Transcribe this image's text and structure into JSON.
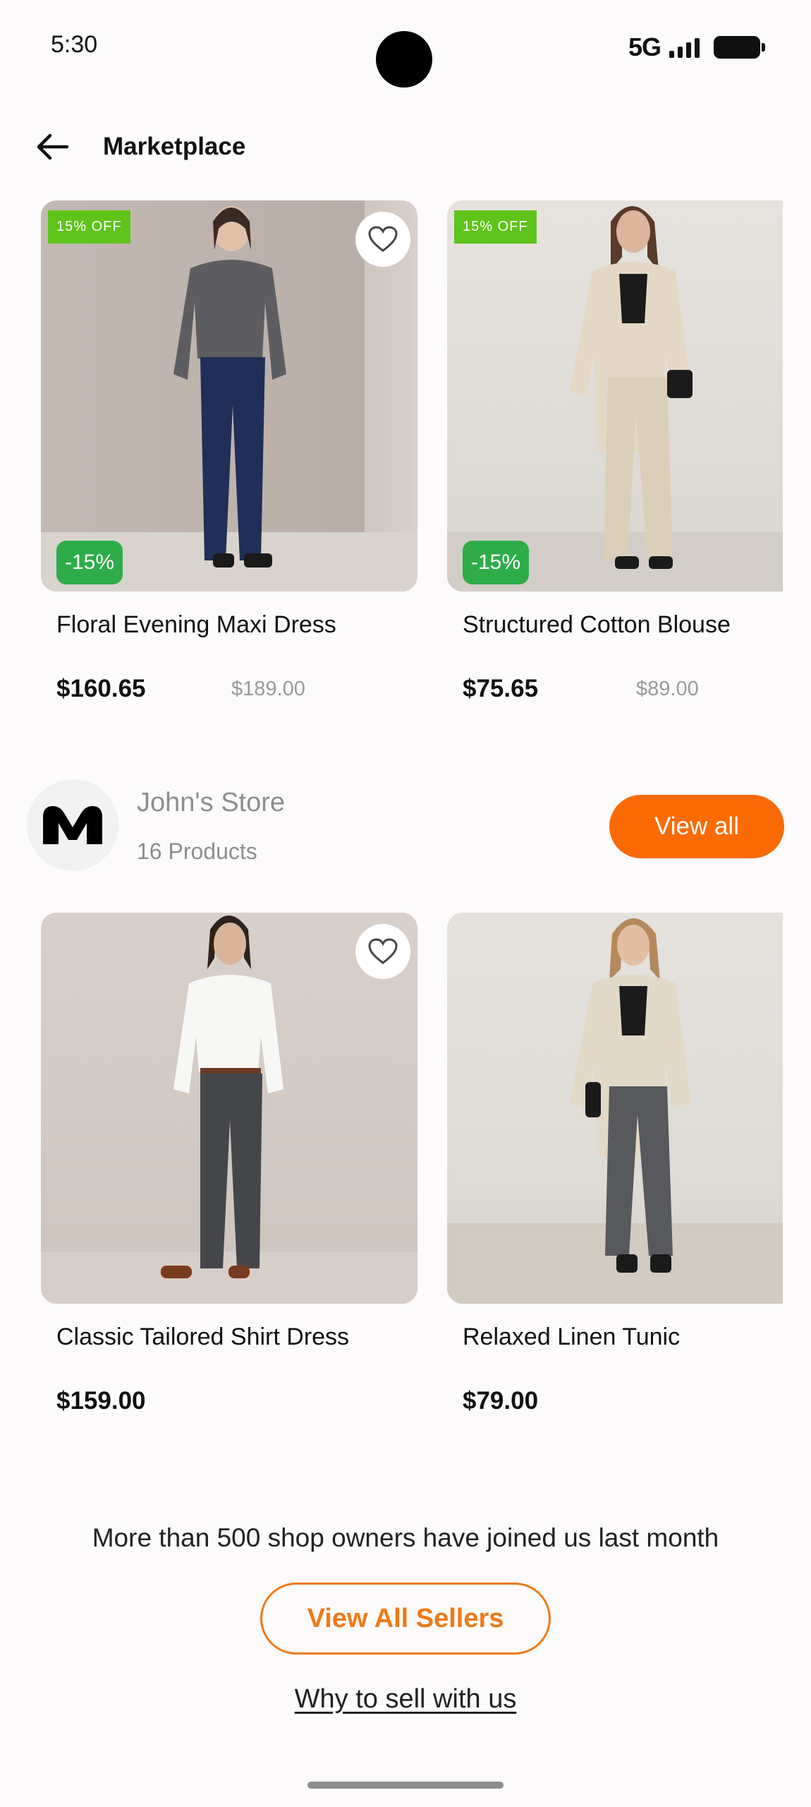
{
  "status_bar": {
    "time": "5:30",
    "network": "5G"
  },
  "header": {
    "title": "Marketplace"
  },
  "rows": [
    {
      "products": [
        {
          "name": "Floral Evening Maxi Dress",
          "price": "$160.65",
          "old_price": "$189.00",
          "off_label": "15% OFF",
          "discount": "-15%"
        },
        {
          "name": "Structured Cotton Blouse",
          "price": "$75.65",
          "old_price": "$89.00",
          "off_label": "15% OFF",
          "discount": "-15%"
        }
      ]
    },
    {
      "products": [
        {
          "name": "Classic Tailored Shirt Dress",
          "price": "$159.00"
        },
        {
          "name": "Relaxed Linen Tunic",
          "price": "$79.00"
        }
      ]
    }
  ],
  "store": {
    "name": "John's Store",
    "count": "16 Products",
    "view_all": "View all"
  },
  "footer": {
    "promo": "More than 500 shop owners have joined us last month",
    "sellers_button": "View All Sellers",
    "why_link": "Why to sell with us"
  },
  "colors": {
    "accent": "#fa6b05",
    "off_badge": "#5fc31a",
    "discount_badge": "#2eac4a"
  },
  "icons": [
    "back-arrow-icon",
    "heart-icon",
    "store-logo-icon",
    "signal-icon",
    "battery-icon"
  ]
}
